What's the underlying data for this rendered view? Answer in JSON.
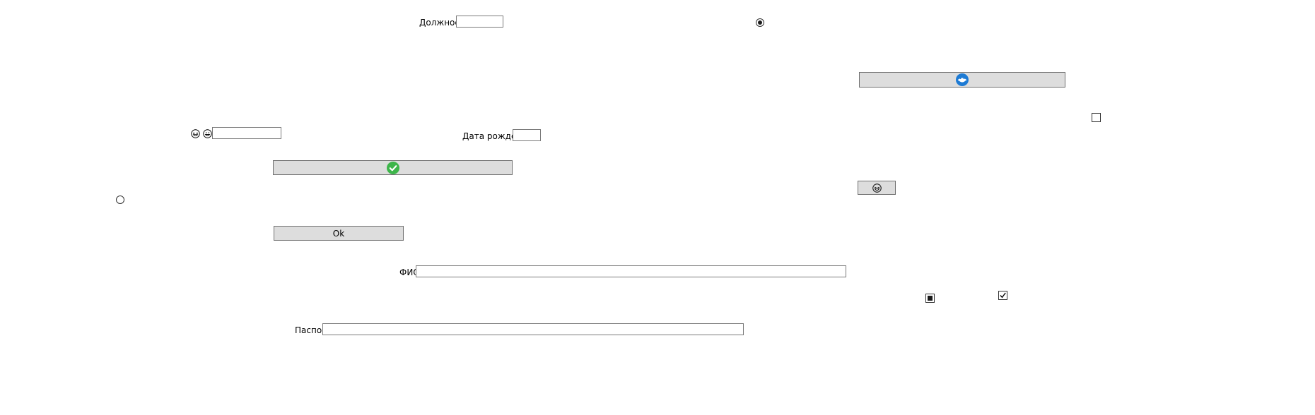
{
  "form": {
    "position": {
      "label": "Должность",
      "value": ""
    },
    "birth_date": {
      "label": "Дата рождения",
      "value": ""
    },
    "full_name": {
      "label": "ФИО",
      "value": ""
    },
    "passport": {
      "label": "Паспорт",
      "value": ""
    },
    "emoji_field": {
      "value": ""
    }
  },
  "buttons": {
    "ok_label": "Ok"
  },
  "icons": {
    "accent_blue": "#1e7bd4",
    "accent_green": "#3db54a",
    "emoji_1": "laughing-face-icon",
    "emoji_2": "grinning-face-icon",
    "emoji_button": "laughing-face-icon",
    "top_right_button": "blue-face-icon",
    "wide_button": "green-check-icon"
  },
  "controls": {
    "radio_top_checked": true,
    "radio_left_checked": false,
    "checkbox_right_checked": false,
    "checkbox_indeterminate": true,
    "checkbox_checked": true
  }
}
